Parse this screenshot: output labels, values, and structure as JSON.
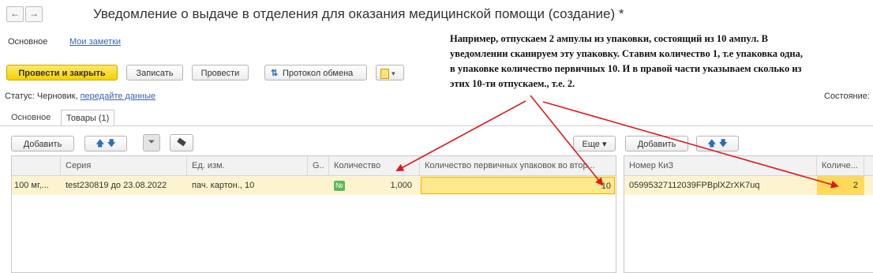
{
  "window": {
    "back_glyph": "←",
    "forward_glyph": "→",
    "title": "Уведомление о выдаче в отделения для оказания медицинской помощи (создание) *"
  },
  "top_tabs": {
    "main": "Основное",
    "notes": "Мои заметки"
  },
  "toolbar": {
    "post_close": "Провести и закрыть",
    "save": "Записать",
    "post": "Провести",
    "exchange_log": "Протокол обмена",
    "more_glyph": "▾"
  },
  "status": {
    "label": "Статус:",
    "value": "Черновик,",
    "link": "передайте данные",
    "right_label": "Состояние:"
  },
  "annotation": {
    "text": "Например, отпускаем 2 ампулы из упаковки, состоящий из 10 ампул. В уведомлении сканируем эту упаковку. Ставим количество 1, т.е упаковка одна, в упаковке количество первичных 10.  И в правой части указываем сколько из этих 10-ти отпускаем., т.е. 2."
  },
  "inner_tabs": {
    "main": "Основное",
    "goods": "Товары (1)"
  },
  "left_grid": {
    "add": "Добавить",
    "more": "Еще ▾",
    "headers": [
      "Серия",
      "Ед. изм.",
      "G..",
      "Количество",
      "Количество первичных упаковок во втор..."
    ],
    "row": {
      "col0": "100 мг,...",
      "series": "test230819 до 23.08.2022",
      "unit": "пач. картон., 10",
      "badge": "№",
      "quantity": "1,000",
      "primary_count": "10"
    }
  },
  "right_grid": {
    "add": "Добавить",
    "headers": [
      "Номер КиЗ",
      "Количе..."
    ],
    "row": {
      "kiz": "05995327112039FPBplXZrXK7uq",
      "quantity": "2"
    }
  },
  "colors": {
    "accent": "#f5d000",
    "arrow": "#e0181b",
    "row_highlight": "#fdf4cf"
  }
}
